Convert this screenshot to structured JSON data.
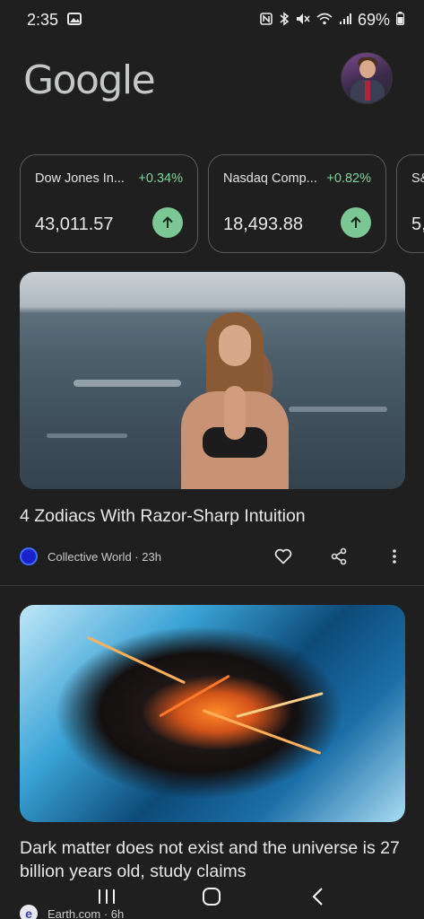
{
  "status": {
    "time": "2:35",
    "battery": "69%",
    "icons": [
      "image-icon",
      "nfc-icon",
      "bluetooth-icon",
      "mute-icon",
      "wifi-icon",
      "signal-icon",
      "battery-icon"
    ]
  },
  "header": {
    "logo": "Google",
    "avatar": "profile-avatar"
  },
  "stocks": [
    {
      "name": "Dow Jones In...",
      "change": "+0.34%",
      "value": "43,011.57",
      "trend": "up"
    },
    {
      "name": "Nasdaq Comp...",
      "change": "+0.82%",
      "value": "18,493.88",
      "trend": "up"
    },
    {
      "name": "S&",
      "change": "",
      "value": "5,",
      "trend": "up"
    }
  ],
  "articles": [
    {
      "title": "4 Zodiacs With Razor-Sharp Intuition",
      "source": "Collective World · 23h",
      "image": "woman-in-ocean"
    },
    {
      "title": "Dark matter does not exist and the universe is 27 billion years old, study claims",
      "source": "Earth.com · 6h",
      "source_initial": "e",
      "image": "cosmic-explosion"
    }
  ],
  "colors": {
    "background": "#1f1f1f",
    "positive": "#7ed49a",
    "arrow_bg": "#7bc894"
  }
}
